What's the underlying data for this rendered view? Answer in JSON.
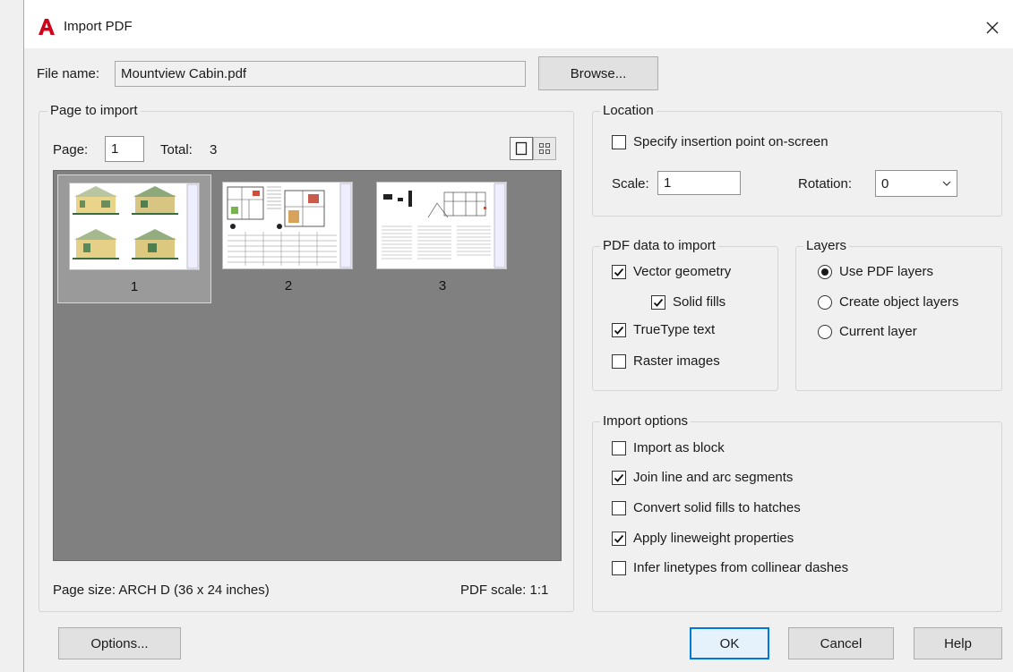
{
  "window": {
    "title": "Import PDF"
  },
  "file": {
    "label": "File name:",
    "value": "Mountview Cabin.pdf",
    "browse_label": "Browse..."
  },
  "page_to_import": {
    "title": "Page to import",
    "page_label": "Page:",
    "page_value": "1",
    "total_label": "Total:",
    "total_value": "3",
    "thumbnails": [
      {
        "number": "1",
        "selected": true
      },
      {
        "number": "2",
        "selected": false
      },
      {
        "number": "3",
        "selected": false
      }
    ],
    "page_size_text": "Page size:  ARCH D (36 x 24 inches)",
    "pdf_scale_text": "PDF scale: 1:1"
  },
  "location": {
    "title": "Location",
    "specify_label": "Specify insertion point on-screen",
    "specify_checked": false,
    "scale_label": "Scale:",
    "scale_value": "1",
    "rotation_label": "Rotation:",
    "rotation_value": "0"
  },
  "pdf_data": {
    "title": "PDF data to import",
    "vector_label": "Vector geometry",
    "vector_checked": true,
    "solid_label": "Solid fills",
    "solid_checked": true,
    "truetype_label": "TrueType text",
    "truetype_checked": true,
    "raster_label": "Raster images",
    "raster_checked": false
  },
  "layers": {
    "title": "Layers",
    "use_pdf_label": "Use PDF layers",
    "create_object_label": "Create object layers",
    "current_label": "Current layer",
    "selected": "use_pdf"
  },
  "import_options": {
    "title": "Import options",
    "block_label": "Import as block",
    "block_checked": false,
    "join_label": "Join line and arc segments",
    "join_checked": true,
    "convert_label": "Convert solid fills to hatches",
    "convert_checked": false,
    "lineweight_label": "Apply lineweight properties",
    "lineweight_checked": true,
    "infer_label": "Infer linetypes from collinear dashes",
    "infer_checked": false
  },
  "footer": {
    "options_label": "Options...",
    "ok_label": "OK",
    "cancel_label": "Cancel",
    "help_label": "Help"
  },
  "colors": {
    "accent": "#0078d7",
    "logo_red": "#d0021b",
    "preview_bg": "#808080"
  }
}
